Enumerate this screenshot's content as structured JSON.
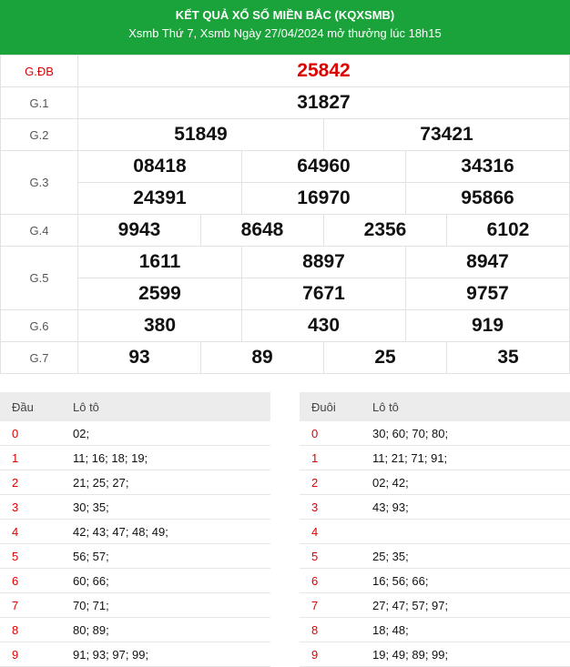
{
  "header": {
    "title": "KẾT QUẢ XỔ SỐ MIỀN BẮC (KQXSMB)",
    "subtitle": "Xsmb Thứ 7, Xsmb Ngày 27/04/2024 mở thưởng lúc 18h15"
  },
  "results": [
    {
      "label": "G.ĐB",
      "rows": [
        [
          "25842"
        ]
      ],
      "red": true
    },
    {
      "label": "G.1",
      "rows": [
        [
          "31827"
        ]
      ]
    },
    {
      "label": "G.2",
      "rows": [
        [
          "51849",
          "73421"
        ]
      ]
    },
    {
      "label": "G.3",
      "rows": [
        [
          "08418",
          "64960",
          "34316"
        ],
        [
          "24391",
          "16970",
          "95866"
        ]
      ]
    },
    {
      "label": "G.4",
      "rows": [
        [
          "9943",
          "8648",
          "2356",
          "6102"
        ]
      ]
    },
    {
      "label": "G.5",
      "rows": [
        [
          "1611",
          "8897",
          "8947"
        ],
        [
          "2599",
          "7671",
          "9757"
        ]
      ]
    },
    {
      "label": "G.6",
      "rows": [
        [
          "380",
          "430",
          "919"
        ]
      ]
    },
    {
      "label": "G.7",
      "rows": [
        [
          "93",
          "89",
          "25",
          "35"
        ]
      ]
    }
  ],
  "loto_head": {
    "col1": "Đầu",
    "col2": "Lô tô",
    "rows": [
      {
        "k": "0",
        "v": "02;"
      },
      {
        "k": "1",
        "v": "11; 16; 18; 19;"
      },
      {
        "k": "2",
        "v": "21; 25; 27;"
      },
      {
        "k": "3",
        "v": "30; 35;"
      },
      {
        "k": "4",
        "v": "42; 43; 47; 48; 49;"
      },
      {
        "k": "5",
        "v": "56; 57;"
      },
      {
        "k": "6",
        "v": "60; 66;"
      },
      {
        "k": "7",
        "v": "70; 71;"
      },
      {
        "k": "8",
        "v": "80; 89;"
      },
      {
        "k": "9",
        "v": "91; 93; 97; 99;"
      }
    ]
  },
  "loto_tail": {
    "col1": "Đuôi",
    "col2": "Lô tô",
    "rows": [
      {
        "k": "0",
        "v": "30; 60; 70; 80;"
      },
      {
        "k": "1",
        "v": "11; 21; 71; 91;"
      },
      {
        "k": "2",
        "v": "02; 42;"
      },
      {
        "k": "3",
        "v": "43; 93;"
      },
      {
        "k": "4",
        "v": ""
      },
      {
        "k": "5",
        "v": "25; 35;"
      },
      {
        "k": "6",
        "v": "16; 56; 66;"
      },
      {
        "k": "7",
        "v": "27; 47; 57; 97;"
      },
      {
        "k": "8",
        "v": "18; 48;"
      },
      {
        "k": "9",
        "v": "19; 49; 89; 99;"
      }
    ]
  }
}
